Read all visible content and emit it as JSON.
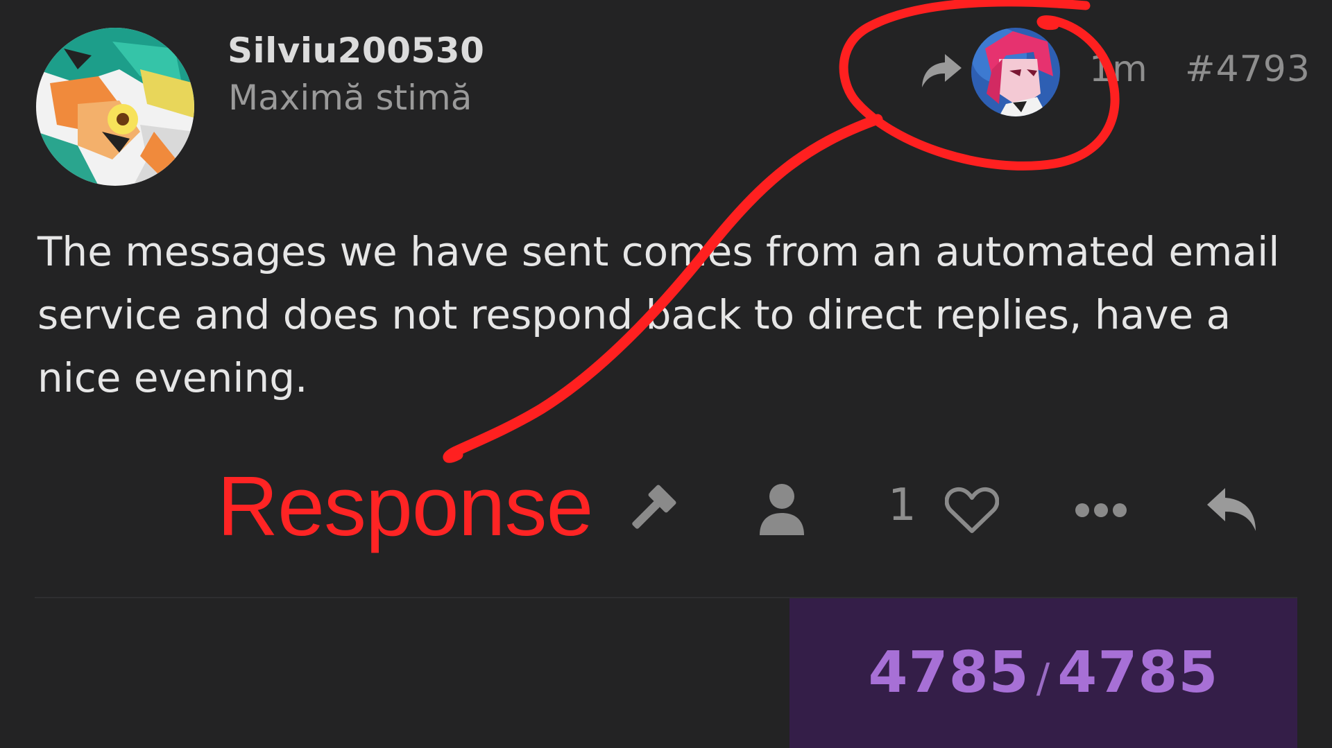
{
  "post": {
    "username": "Silviu200530",
    "user_title": "Maximă stimă",
    "time": "1m",
    "post_number": "#4793",
    "body": "The messages we have sent comes from an automated email service and does not respond back to direct replies, have a nice evening."
  },
  "actions": {
    "like_count": "1"
  },
  "annotation": {
    "label": "Response",
    "color": "#ff2424"
  },
  "progress": {
    "current": "4785",
    "separator": "/",
    "total": "4785"
  },
  "colors": {
    "background": "#232324",
    "progress_bg": "#341e48",
    "progress_text": "#a770d6"
  }
}
